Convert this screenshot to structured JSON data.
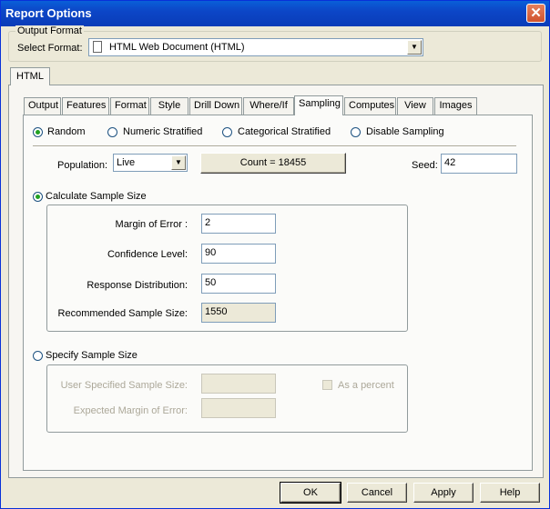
{
  "window": {
    "title": "Report Options",
    "close_glyph": "✕"
  },
  "output_format": {
    "legend": "Output Format",
    "select_label": "Select Format:",
    "selected": "HTML Web Document (HTML)"
  },
  "format_tab": {
    "label": "HTML"
  },
  "tabs": [
    "Output",
    "Features",
    "Format",
    "Style",
    "Drill Down",
    "Where/If",
    "Sampling",
    "Computes",
    "View",
    "Images"
  ],
  "active_tab": "Sampling",
  "sampling_methods": [
    "Random",
    "Numeric Stratified",
    "Categorical Stratified",
    "Disable Sampling"
  ],
  "selected_method": "Random",
  "population": {
    "label": "Population:",
    "value": "Live",
    "count_button": "Count = 18455"
  },
  "seed": {
    "label": "Seed:",
    "value": "42"
  },
  "calculate": {
    "label": "Calculate Sample Size",
    "margin_label": "Margin of Error :",
    "margin_value": "2",
    "confidence_label": "Confidence Level:",
    "confidence_value": "90",
    "response_label": "Response Distribution:",
    "response_value": "50",
    "recommended_label": "Recommended Sample Size:",
    "recommended_value": "1550"
  },
  "specify": {
    "label": "Specify Sample Size",
    "user_label": "User Specified Sample Size:",
    "user_value": "",
    "expected_label": "Expected Margin of Error:",
    "expected_value": "",
    "percent_label": "As a percent"
  },
  "buttons": {
    "ok": "OK",
    "cancel": "Cancel",
    "apply": "Apply",
    "help": "Help"
  }
}
